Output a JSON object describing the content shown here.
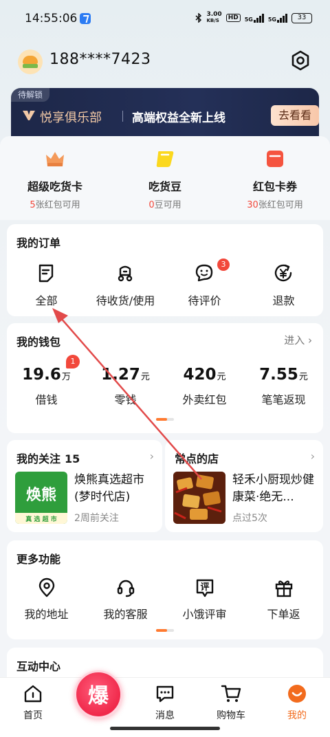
{
  "status_bar": {
    "time": "14:55:06",
    "speed_value": "3.00",
    "speed_unit": "KB/S",
    "hd": "HD",
    "sig1": "5G",
    "sig2": "5G",
    "battery": "33"
  },
  "header": {
    "phone": "188****7423"
  },
  "vip": {
    "tag": "待解锁",
    "club": "悦享俱乐部",
    "slogan": "高端权益全新上线",
    "button": "去看看"
  },
  "assets": [
    {
      "name": "超级吃货卡",
      "num": "5",
      "text": "张红包可用"
    },
    {
      "name": "吃货豆",
      "num": "0",
      "text": "豆可用"
    },
    {
      "name": "红包卡券",
      "num": "30",
      "text": "张红包可用"
    }
  ],
  "orders": {
    "title": "我的订单",
    "items": [
      {
        "label": "全部"
      },
      {
        "label": "待收货/使用"
      },
      {
        "label": "待评价",
        "badge": "3"
      },
      {
        "label": "退款"
      }
    ]
  },
  "wallet": {
    "title": "我的钱包",
    "more": "进入",
    "badge": "1",
    "items": [
      {
        "value": "19.6",
        "unit": "万",
        "label": "借钱"
      },
      {
        "value": "1.27",
        "unit": "元",
        "label": "零钱"
      },
      {
        "value": "420",
        "unit": "元",
        "label": "外卖红包"
      },
      {
        "value": "7.55",
        "unit": "元",
        "label": "笔笔返现"
      }
    ]
  },
  "follow": {
    "title": "我的关注",
    "count": "15",
    "shop_name": "焕熊真选超市(梦时代店)",
    "shop_sub": "2周前关注",
    "logo_text": "焕熊",
    "logo_sub": "真 选 超 市"
  },
  "frequent": {
    "title": "常点的店",
    "shop_name": "轻禾小厨现炒健康菜·绝无...",
    "shop_sub": "点过5次"
  },
  "more": {
    "title": "更多功能",
    "items": [
      {
        "label": "我的地址"
      },
      {
        "label": "我的客服"
      },
      {
        "label": "小饿评审",
        "icon_char": "评"
      },
      {
        "label": "下单返"
      }
    ]
  },
  "interact": {
    "title": "互动中心"
  },
  "tabbar": {
    "items": [
      {
        "label": "首页"
      },
      {
        "label": "消息"
      },
      {
        "label": "购物车"
      },
      {
        "label": "我的"
      }
    ],
    "boom": "爆"
  },
  "colors": {
    "accent": "#f26b1d",
    "badge": "#f2483b",
    "vip_bg": "#1d2748",
    "arrow": "#e24a4a"
  }
}
